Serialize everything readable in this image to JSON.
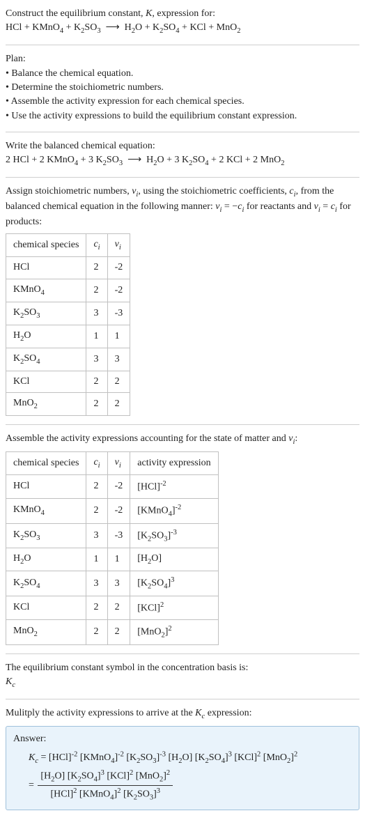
{
  "header": {
    "line1": "Construct the equilibrium constant, <i>K</i>, expression for:",
    "eq": "HCl + KMnO<sub>4</sub> + K<sub>2</sub>SO<sub>3</sub> &nbsp;&#10230;&nbsp; H<sub>2</sub>O + K<sub>2</sub>SO<sub>4</sub> + KCl + MnO<sub>2</sub>"
  },
  "plan": {
    "title": "Plan:",
    "items": [
      "Balance the chemical equation.",
      "Determine the stoichiometric numbers.",
      "Assemble the activity expression for each chemical species.",
      "Use the activity expressions to build the equilibrium constant expression."
    ]
  },
  "balanced": {
    "title": "Write the balanced chemical equation:",
    "eq": "2 HCl + 2 KMnO<sub>4</sub> + 3 K<sub>2</sub>SO<sub>3</sub> &nbsp;&#10230;&nbsp; H<sub>2</sub>O + 3 K<sub>2</sub>SO<sub>4</sub> + 2 KCl + 2 MnO<sub>2</sub>"
  },
  "assign": {
    "intro": "Assign stoichiometric numbers, <i>&nu;<sub>i</sub></i>, using the stoichiometric coefficients, <i>c<sub>i</sub></i>, from the balanced chemical equation in the following manner: <i>&nu;<sub>i</sub></i> = &minus;<i>c<sub>i</sub></i> for reactants and <i>&nu;<sub>i</sub></i> = <i>c<sub>i</sub></i> for products:",
    "headers": {
      "species": "chemical species",
      "ci": "<i>c<sub>i</sub></i>",
      "vi": "<i>&nu;<sub>i</sub></i>"
    },
    "rows": [
      {
        "species": "HCl",
        "ci": "2",
        "vi": "-2"
      },
      {
        "species": "KMnO<sub>4</sub>",
        "ci": "2",
        "vi": "-2"
      },
      {
        "species": "K<sub>2</sub>SO<sub>3</sub>",
        "ci": "3",
        "vi": "-3"
      },
      {
        "species": "H<sub>2</sub>O",
        "ci": "1",
        "vi": "1"
      },
      {
        "species": "K<sub>2</sub>SO<sub>4</sub>",
        "ci": "3",
        "vi": "3"
      },
      {
        "species": "KCl",
        "ci": "2",
        "vi": "2"
      },
      {
        "species": "MnO<sub>2</sub>",
        "ci": "2",
        "vi": "2"
      }
    ]
  },
  "activity": {
    "intro": "Assemble the activity expressions accounting for the state of matter and <i>&nu;<sub>i</sub></i>:",
    "headers": {
      "species": "chemical species",
      "ci": "<i>c<sub>i</sub></i>",
      "vi": "<i>&nu;<sub>i</sub></i>",
      "act": "activity expression"
    },
    "rows": [
      {
        "species": "HCl",
        "ci": "2",
        "vi": "-2",
        "act": "[HCl]<sup>-2</sup>"
      },
      {
        "species": "KMnO<sub>4</sub>",
        "ci": "2",
        "vi": "-2",
        "act": "[KMnO<sub>4</sub>]<sup>-2</sup>"
      },
      {
        "species": "K<sub>2</sub>SO<sub>3</sub>",
        "ci": "3",
        "vi": "-3",
        "act": "[K<sub>2</sub>SO<sub>3</sub>]<sup>-3</sup>"
      },
      {
        "species": "H<sub>2</sub>O",
        "ci": "1",
        "vi": "1",
        "act": "[H<sub>2</sub>O]"
      },
      {
        "species": "K<sub>2</sub>SO<sub>4</sub>",
        "ci": "3",
        "vi": "3",
        "act": "[K<sub>2</sub>SO<sub>4</sub>]<sup>3</sup>"
      },
      {
        "species": "KCl",
        "ci": "2",
        "vi": "2",
        "act": "[KCl]<sup>2</sup>"
      },
      {
        "species": "MnO<sub>2</sub>",
        "ci": "2",
        "vi": "2",
        "act": "[MnO<sub>2</sub>]<sup>2</sup>"
      }
    ]
  },
  "symbol": {
    "text": "The equilibrium constant symbol in the concentration basis is:",
    "kc": "<i>K<sub>c</sub></i>"
  },
  "multiply": {
    "text": "Mulitply the activity expressions to arrive at the <i>K<sub>c</sub></i> expression:"
  },
  "answer": {
    "label": "Answer:",
    "lhs": "<i>K<sub>c</sub></i> = ",
    "flat": "[HCl]<sup>-2</sup> [KMnO<sub>4</sub>]<sup>-2</sup> [K<sub>2</sub>SO<sub>3</sub>]<sup>-3</sup> [H<sub>2</sub>O] [K<sub>2</sub>SO<sub>4</sub>]<sup>3</sup> [KCl]<sup>2</sup> [MnO<sub>2</sub>]<sup>2</sup>",
    "num": "[H<sub>2</sub>O] [K<sub>2</sub>SO<sub>4</sub>]<sup>3</sup> [KCl]<sup>2</sup> [MnO<sub>2</sub>]<sup>2</sup>",
    "den": "[HCl]<sup>2</sup> [KMnO<sub>4</sub>]<sup>2</sup> [K<sub>2</sub>SO<sub>3</sub>]<sup>3</sup>"
  }
}
